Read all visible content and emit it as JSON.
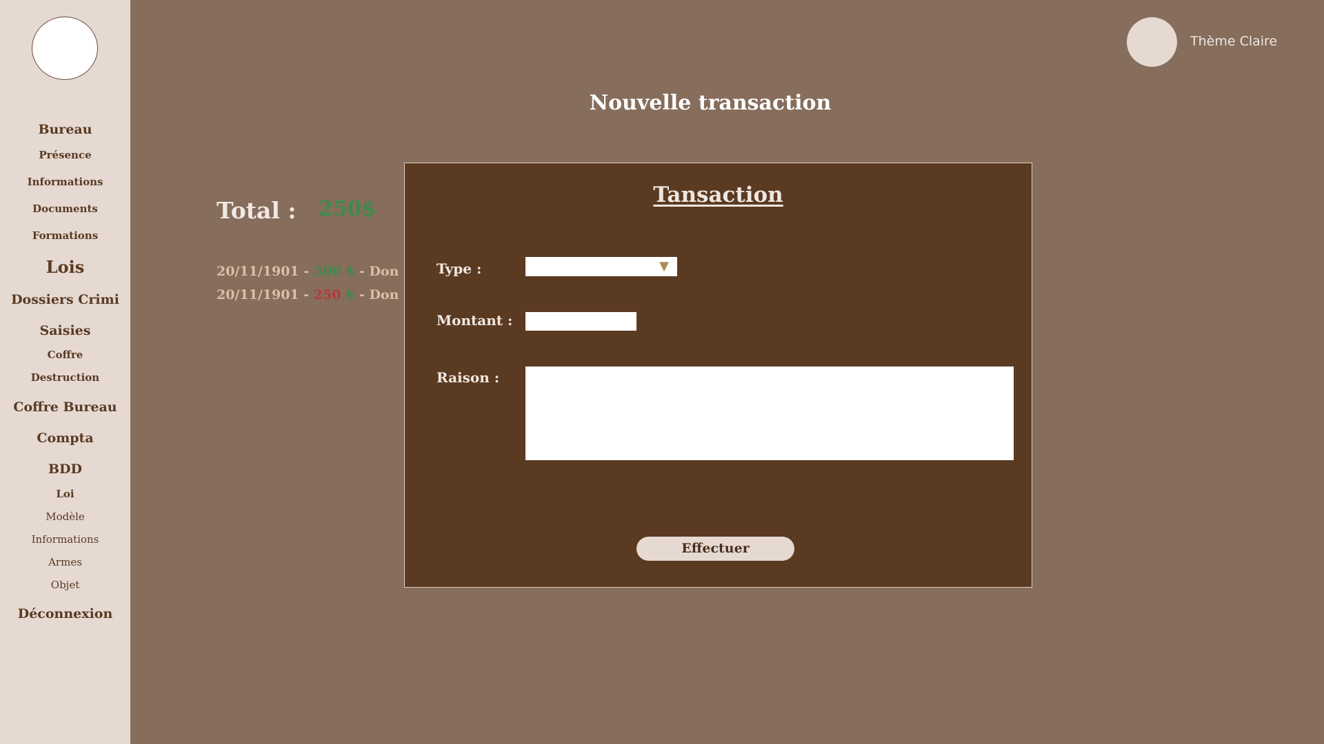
{
  "sidebar": {
    "items": [
      {
        "label": "Bureau"
      },
      {
        "label": "Présence"
      },
      {
        "label": "Informations"
      },
      {
        "label": "Documents"
      },
      {
        "label": "Formations"
      },
      {
        "label": "Lois"
      },
      {
        "label": "Dossiers Crimi"
      },
      {
        "label": "Saisies"
      },
      {
        "label": "Coffre"
      },
      {
        "label": "Destruction"
      },
      {
        "label": "Coffre Bureau"
      },
      {
        "label": "Compta"
      },
      {
        "label": "BDD"
      },
      {
        "label": "Loi"
      },
      {
        "label": "Modèle"
      },
      {
        "label": "Informations"
      },
      {
        "label": "Armes"
      },
      {
        "label": "Objet"
      },
      {
        "label": "Déconnexion"
      }
    ]
  },
  "theme": {
    "label": "Thème Claire"
  },
  "page": {
    "title": "Nouvelle transaction"
  },
  "summary": {
    "total_label": "Total :",
    "total_value": "250$"
  },
  "transactions": [
    {
      "date": "20/11/1901 -",
      "amount": "500",
      "currency": "$",
      "desc": "- Don d"
    },
    {
      "date": "20/11/1901 -",
      "amount": "250",
      "currency": "$",
      "desc": "- Don d"
    }
  ],
  "modal": {
    "title": "Tansaction",
    "type_label": "Type :",
    "type_value": "",
    "amount_label": "Montant :",
    "amount_value": "",
    "reason_label": "Raison :",
    "reason_value": "",
    "submit_label": "Effectuer",
    "select_arrow": "▼"
  },
  "colors": {
    "background": "#866d5c",
    "sidebar": "#e5d9d2",
    "modal": "#5b3a22",
    "positive": "#3f8a4e",
    "negative": "#b23a3a"
  }
}
